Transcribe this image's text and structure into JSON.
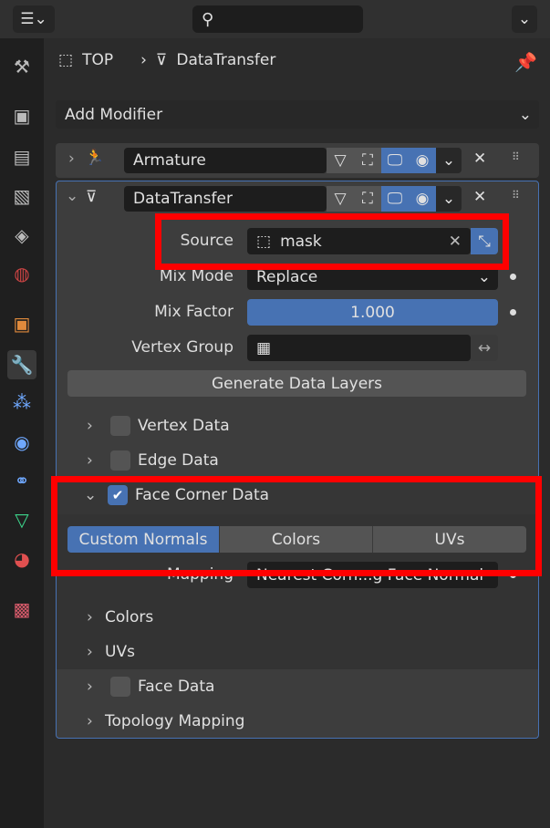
{
  "topbar": {
    "editor_icon": "editor-type-icon",
    "search_placeholder": ""
  },
  "sidebar": {
    "items": [
      "tool",
      "render",
      "output",
      "view-layer",
      "scene",
      "world",
      "object",
      "modifiers",
      "particles",
      "physics",
      "constraints",
      "data",
      "material",
      "texture"
    ],
    "active": "modifiers"
  },
  "breadcrumb": {
    "object": "TOP",
    "modifier": "DataTransfer"
  },
  "add_modifier": "Add Modifier",
  "modifiers": [
    {
      "name": "Armature",
      "expanded": false
    },
    {
      "name": "DataTransfer",
      "expanded": true
    }
  ],
  "fields": {
    "source_label": "Source",
    "source_value": "mask",
    "mix_mode_label": "Mix Mode",
    "mix_mode_value": "Replace",
    "mix_factor_label": "Mix Factor",
    "mix_factor_value": "1.000",
    "vertex_group_label": "Vertex Group",
    "vertex_group_value": "",
    "generate_button": "Generate Data Layers"
  },
  "sections": {
    "vertex_data": "Vertex Data",
    "vertex_checked": false,
    "edge_data": "Edge Data",
    "edge_checked": false,
    "face_corner_data": "Face Corner Data",
    "face_corner_checked": true,
    "tabs": [
      "Custom Normals",
      "Colors",
      "UVs"
    ],
    "active_tab": "Custom Normals",
    "mapping_label": "Mapping",
    "mapping_value": "Nearest Corn...g Face Normal",
    "colors": "Colors",
    "uvs": "UVs",
    "face_data": "Face Data",
    "face_checked": false,
    "topology_mapping": "Topology Mapping"
  },
  "colors": {
    "accent": "#4772b3",
    "highlight": "#ff0000"
  }
}
